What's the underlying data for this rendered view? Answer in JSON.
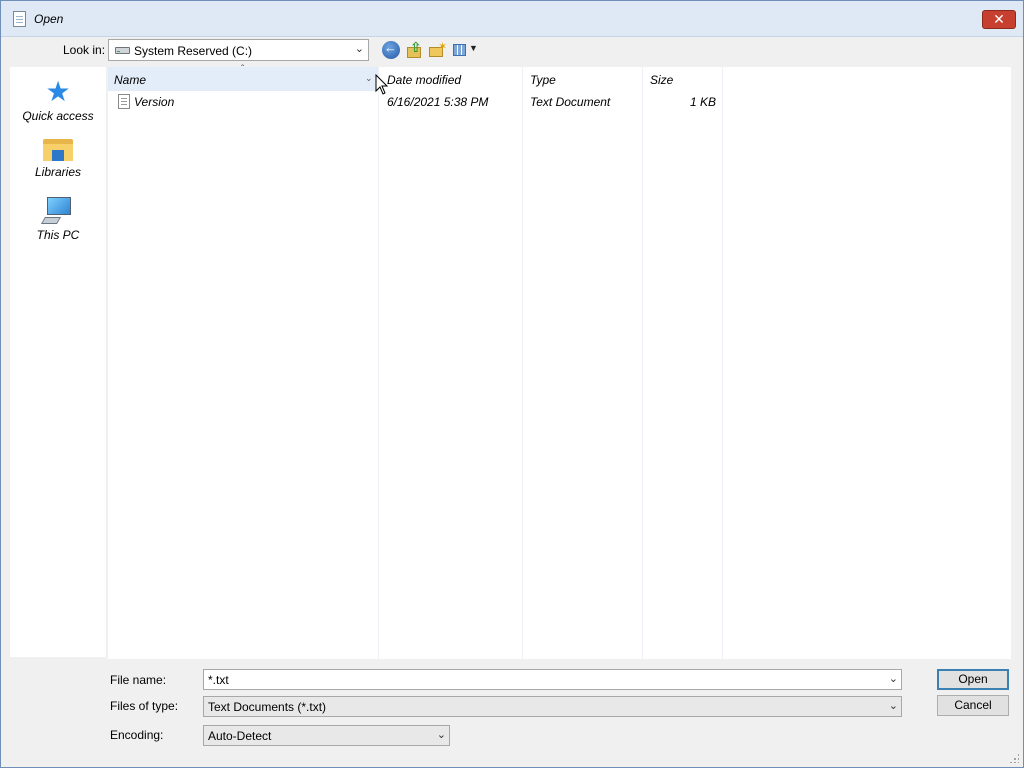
{
  "window": {
    "title": "Open",
    "close_glyph": "✕"
  },
  "toolbar": {
    "look_in_label": "Look in:",
    "look_in_value": "System Reserved (C:)",
    "icons": [
      "back-icon",
      "up-folder-icon",
      "new-folder-icon",
      "view-menu-icon"
    ]
  },
  "places": [
    {
      "label": "Quick access",
      "icon": "star-icon"
    },
    {
      "label": "Libraries",
      "icon": "libraries-icon"
    },
    {
      "label": "This PC",
      "icon": "computer-icon"
    }
  ],
  "filelist": {
    "columns": [
      "Name",
      "Date modified",
      "Type",
      "Size"
    ],
    "rows": [
      {
        "name": "Version",
        "date": "6/16/2021 5:38 PM",
        "type": "Text Document",
        "size": "1 KB"
      }
    ]
  },
  "form": {
    "file_name_label": "File name:",
    "file_name_value": "*.txt",
    "file_type_label": "Files of type:",
    "file_type_value": "Text Documents (*.txt)",
    "encoding_label": "Encoding:",
    "encoding_value": "Auto-Detect"
  },
  "buttons": {
    "open": "Open",
    "cancel": "Cancel"
  },
  "colors": {
    "title_bar": "#dee9f5",
    "close_button": "#c7402f",
    "header_highlight": "#e3edf9",
    "default_button_border": "#3c7fb1"
  }
}
